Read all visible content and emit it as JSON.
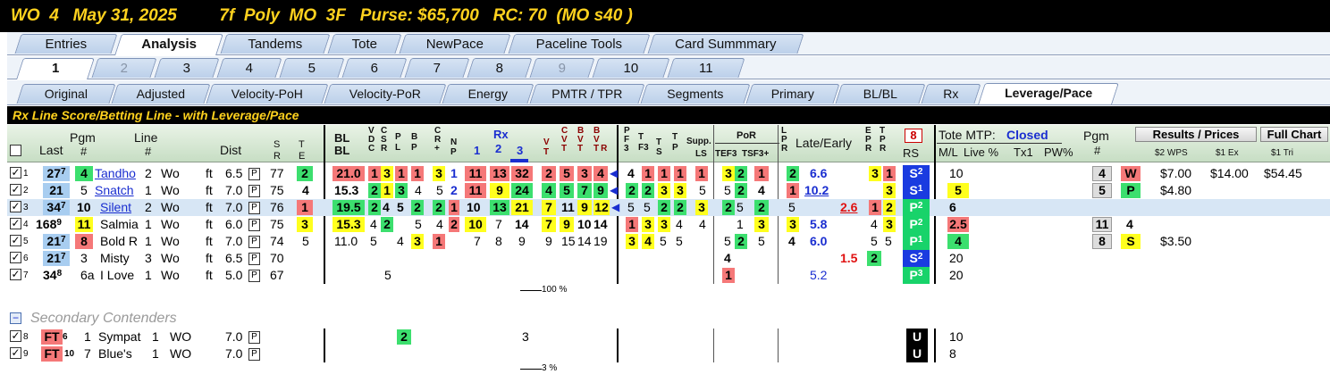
{
  "title": "WO  4   May 31, 2025         7f  Poly  MO  3F   Purse: $65,700   RC: 70  (MO s40 )",
  "tabs1": [
    "Entries",
    "Analysis",
    "Tandems",
    "Tote",
    "NewPace",
    "Paceline Tools",
    "Card Summmary"
  ],
  "tabs2": [
    "1",
    "2",
    "3",
    "4",
    "5",
    "6",
    "7",
    "8",
    "9",
    "10",
    "11"
  ],
  "tabs3": [
    "Original",
    "Adjusted",
    "Velocity-PoH",
    "Velocity-PoR",
    "Energy",
    "PMTR / TPR",
    "Segments",
    "Primary",
    "BL/BL",
    "Rx",
    "Leverage/Pace"
  ],
  "section_title": "Rx Line Score/Betting Line - with Leverage/Pace",
  "headers": {
    "last": "Last",
    "pgm": "Pgm",
    "pgm_hash": "#",
    "line": "Line",
    "line_hash": "#",
    "dist": "Dist",
    "sr_s": "S",
    "sr_r": "R",
    "te_t": "T",
    "te_e": "E",
    "bl1": "BL",
    "bl2": "BL",
    "vdc": [
      "V",
      "D",
      "C"
    ],
    "csr": [
      "C",
      "S",
      "R"
    ],
    "pl": [
      "P",
      "L"
    ],
    "bp": [
      "B",
      "P"
    ],
    "cr": [
      "C",
      "R",
      "+"
    ],
    "np": [
      "N",
      "P"
    ],
    "rx": "Rx",
    "rx1": "1",
    "rx2": "2",
    "rx3": "3",
    "vt": [
      "V",
      "T"
    ],
    "cvt": [
      "C",
      "V",
      "T"
    ],
    "bvt": [
      "B",
      "V",
      "T"
    ],
    "bvtr": [
      "B",
      "V",
      "T",
      "R"
    ],
    "pf3": [
      "P",
      "F",
      "3"
    ],
    "tf3": [
      "T",
      "F3"
    ],
    "ts": [
      "T",
      "S"
    ],
    "tp": [
      "T",
      "P"
    ],
    "supp": "Supp.",
    "ls": "LS",
    "por": "PoR",
    "tef3": "TEF3",
    "tsf3": "TSF3+",
    "lpr": [
      "L",
      "P",
      "R"
    ],
    "late_early": "Late/Early",
    "epr": [
      "E",
      "P",
      "R"
    ],
    "tpr": [
      "T",
      "P",
      "R"
    ],
    "rs_num": "8",
    "rs": "RS",
    "tote_mtp": "Tote MTP:",
    "tote_status": "Closed",
    "ml": "M/L",
    "live": "Live %",
    "tx1": "Tx1",
    "pw": "PW%",
    "pgm2": "Pgm",
    "pgm2_hash": "#",
    "results_btn": "Results / Prices",
    "fullchart_btn": "Full Chart",
    "wps": "$2 WPS",
    "ex": "$1 Ex",
    "tri": "$1 Tri"
  },
  "rows": [
    {
      "idx": "1",
      "last": "27",
      "last_sup": "7",
      "pgm": "4",
      "name": "Tandho",
      "line": "2",
      "trk": "Wo",
      "surf": "ft",
      "dist": "6.5",
      "p": "P",
      "sr": "77",
      "te": "2",
      "bl": "21.0",
      "vdc": "1",
      "csr": "3",
      "pl": "1",
      "bp": "1",
      "cr": "3",
      "np": "1",
      "rx1": "11",
      "rx2": "13",
      "rx3": "32",
      "vt": "2",
      "cvt": "5",
      "bvt": "3",
      "bvtr": "4",
      "pf3": "4",
      "tf3": "1",
      "ts": "1",
      "tp": "1",
      "ls": "1",
      "tef": "3",
      "tef2": "2",
      "tsf": "1",
      "lpr": "2",
      "le1": "6.6",
      "le2": "",
      "epr": "3",
      "tpr": "1",
      "rs": "S",
      "rs_sup": "2",
      "ml": "10",
      "live": "",
      "res_pgm": "4",
      "res_fin": "W",
      "wps": "$7.00",
      "ex": "$14.00",
      "tri": "$54.45"
    },
    {
      "idx": "2",
      "last": "21",
      "last_sup": "",
      "pgm": "5",
      "name": "Snatch",
      "line": "1",
      "trk": "Wo",
      "surf": "ft",
      "dist": "7.0",
      "p": "P",
      "sr": "75",
      "te": "4",
      "bl": "15.3",
      "vdc": "2",
      "csr": "1",
      "pl": "3",
      "bp": "4",
      "cr": "5",
      "np": "2",
      "rx1": "11",
      "rx2": "9",
      "rx3": "24",
      "vt": "4",
      "cvt": "5",
      "bvt": "7",
      "bvtr": "9",
      "pf3": "2",
      "tf3": "2",
      "ts": "3",
      "tp": "3",
      "ls": "5",
      "tef": "5",
      "tef2": "2",
      "tsf": "4",
      "lpr": "1",
      "le1": "10.2",
      "le2": "",
      "epr": "",
      "tpr": "3",
      "rs": "S",
      "rs_sup": "1",
      "ml": "5",
      "live": "",
      "res_pgm": "5",
      "res_fin": "P",
      "wps": "$4.80",
      "ex": "",
      "tri": ""
    },
    {
      "idx": "3",
      "last": "34",
      "last_sup": "7",
      "pgm": "10",
      "name": "Silent",
      "line": "2",
      "trk": "Wo",
      "surf": "ft",
      "dist": "7.0",
      "p": "P",
      "sr": "76",
      "te": "1",
      "bl": "19.5",
      "vdc": "2",
      "csr": "4",
      "pl": "5",
      "bp": "2",
      "cr": "2",
      "np": "1",
      "rx1": "10",
      "rx2": "13",
      "rx3": "21",
      "vt": "7",
      "cvt": "11",
      "bvt": "9",
      "bvtr": "12",
      "pf3": "5",
      "tf3": "5",
      "ts": "2",
      "tp": "2",
      "ls": "3",
      "tef": "2",
      "tef2": "5",
      "tsf": "2",
      "lpr": "5",
      "le1": "",
      "le2": "2.6",
      "epr": "1",
      "tpr": "2",
      "rs": "P",
      "rs_sup": "2",
      "ml": "6",
      "live": "",
      "res_pgm": "",
      "res_fin": "",
      "wps": "",
      "ex": "",
      "tri": ""
    },
    {
      "idx": "4",
      "last": "168",
      "last_sup": "9",
      "pgm": "11",
      "name": "Salmia",
      "line": "1",
      "trk": "Wo",
      "surf": "ft",
      "dist": "6.0",
      "p": "P",
      "sr": "75",
      "te": "3",
      "bl": "15.3",
      "vdc": "4",
      "csr": "2",
      "pl": "",
      "bp": "5",
      "cr": "4",
      "np": "2",
      "rx1": "10",
      "rx2": "7",
      "rx3": "14",
      "vt": "7",
      "cvt": "9",
      "bvt": "10",
      "bvtr": "14",
      "pf3": "1",
      "tf3": "3",
      "ts": "3",
      "tp": "4",
      "ls": "4",
      "tef": "",
      "tef2": "1",
      "tsf": "3",
      "lpr": "3",
      "le1": "5.8",
      "le2": "",
      "epr": "4",
      "tpr": "3",
      "rs": "P",
      "rs_sup": "2",
      "ml": "2.5",
      "live": "",
      "res_pgm": "11",
      "res_fin": "4",
      "wps": "",
      "ex": "",
      "tri": ""
    },
    {
      "idx": "5",
      "last": "21",
      "last_sup": "7",
      "pgm": "8",
      "name": "Bold R",
      "line": "1",
      "trk": "Wo",
      "surf": "ft",
      "dist": "7.0",
      "p": "P",
      "sr": "74",
      "te": "5",
      "bl": "11.0",
      "vdc": "5",
      "csr": "",
      "pl": "4",
      "bp": "3",
      "cr": "1",
      "np": "",
      "rx1": "7",
      "rx2": "8",
      "rx3": "9",
      "vt": "9",
      "cvt": "15",
      "bvt": "14",
      "bvtr": "19",
      "pf3": "3",
      "tf3": "4",
      "ts": "5",
      "tp": "5",
      "ls": "",
      "tef": "5",
      "tef2": "2",
      "tsf": "5",
      "lpr": "4",
      "le1": "6.0",
      "le2": "",
      "epr": "5",
      "tpr": "5",
      "rs": "P",
      "rs_sup": "1",
      "ml": "4",
      "live": "",
      "res_pgm": "8",
      "res_fin": "S",
      "wps": "$3.50",
      "ex": "",
      "tri": ""
    },
    {
      "idx": "6",
      "last": "21",
      "last_sup": "7",
      "pgm": "3",
      "name": "Misty",
      "line": "3",
      "trk": "Wo",
      "surf": "ft",
      "dist": "6.5",
      "p": "P",
      "sr": "70",
      "te": "",
      "bl": "",
      "tef": "4",
      "le2": "1.5",
      "tpr": "2",
      "rs": "S",
      "rs_sup": "2",
      "ml": "20"
    },
    {
      "idx": "7",
      "last": "34",
      "last_sup": "8",
      "pgm": "6a",
      "name": "I Love",
      "line": "1",
      "trk": "Wo",
      "surf": "ft",
      "dist": "5.0",
      "p": "P",
      "sr": "67",
      "te": "",
      "bl": "",
      "vdc": "5",
      "tef": "1",
      "le1": "5.2",
      "rs": "P",
      "rs_sup": "3",
      "ml": "20"
    }
  ],
  "sum1": "100 %",
  "secondary_label": "Secondary Contenders",
  "secondary_toggle": "−",
  "rows2": [
    {
      "idx": "8",
      "ft": "FT",
      "ft_sup": "6",
      "pgm": "1",
      "name": "Sympat",
      "line": "1",
      "trk": "WO",
      "dist": "7.0",
      "p": "P",
      "bp": "2",
      "rx2": "3",
      "rs": "U",
      "ml": "10"
    },
    {
      "idx": "9",
      "ft": "FT",
      "ft_sup": "10",
      "pgm": "7",
      "name": "Blue's",
      "line": "1",
      "trk": "WO",
      "dist": "7.0",
      "p": "P",
      "rs": "U",
      "ml": "8"
    }
  ],
  "sum2": "3 %"
}
